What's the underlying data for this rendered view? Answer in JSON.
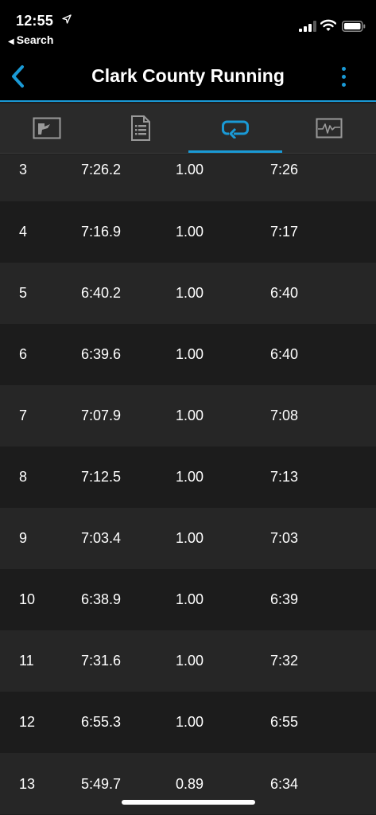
{
  "status_bar": {
    "time": "12:55",
    "back_app": "Search"
  },
  "nav": {
    "title": "Clark County Running",
    "accent_color": "#1a9ad6"
  },
  "tabs": [
    {
      "icon": "chart-map-icon",
      "active": false
    },
    {
      "icon": "document-list-icon",
      "active": false
    },
    {
      "icon": "laps-loop-icon",
      "active": true
    },
    {
      "icon": "activity-graph-icon",
      "active": false
    }
  ],
  "laps": [
    {
      "lap": "3",
      "time": "7:26.2",
      "distance": "1.00",
      "pace": "7:26"
    },
    {
      "lap": "4",
      "time": "7:16.9",
      "distance": "1.00",
      "pace": "7:17"
    },
    {
      "lap": "5",
      "time": "6:40.2",
      "distance": "1.00",
      "pace": "6:40"
    },
    {
      "lap": "6",
      "time": "6:39.6",
      "distance": "1.00",
      "pace": "6:40"
    },
    {
      "lap": "7",
      "time": "7:07.9",
      "distance": "1.00",
      "pace": "7:08"
    },
    {
      "lap": "8",
      "time": "7:12.5",
      "distance": "1.00",
      "pace": "7:13"
    },
    {
      "lap": "9",
      "time": "7:03.4",
      "distance": "1.00",
      "pace": "7:03"
    },
    {
      "lap": "10",
      "time": "6:38.9",
      "distance": "1.00",
      "pace": "6:39"
    },
    {
      "lap": "11",
      "time": "7:31.6",
      "distance": "1.00",
      "pace": "7:32"
    },
    {
      "lap": "12",
      "time": "6:55.3",
      "distance": "1.00",
      "pace": "6:55"
    },
    {
      "lap": "13",
      "time": "5:49.7",
      "distance": "0.89",
      "pace": "6:34"
    }
  ]
}
